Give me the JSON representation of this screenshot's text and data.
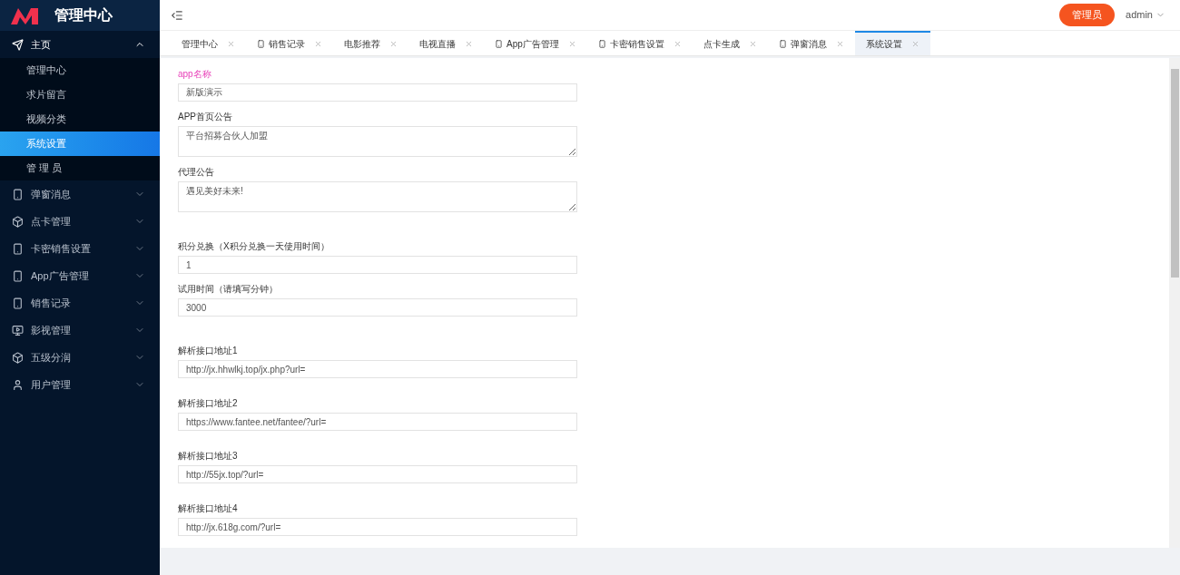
{
  "logo": {
    "title": "管理中心"
  },
  "sidebar": {
    "items": [
      {
        "label": "主页",
        "kind": "send",
        "expanded": true,
        "children": [
          {
            "label": "管理中心",
            "selected": false
          },
          {
            "label": "求片留言",
            "selected": false
          },
          {
            "label": "视频分类",
            "selected": false
          },
          {
            "label": "系统设置",
            "selected": true
          },
          {
            "label": "管 理 员",
            "selected": false
          }
        ]
      },
      {
        "label": "弹窗消息",
        "kind": "phone",
        "expanded": false
      },
      {
        "label": "点卡管理",
        "kind": "cube",
        "expanded": false
      },
      {
        "label": "卡密销售设置",
        "kind": "phone",
        "expanded": false
      },
      {
        "label": "App广告管理",
        "kind": "phone",
        "expanded": false
      },
      {
        "label": "销售记录",
        "kind": "phone",
        "expanded": false
      },
      {
        "label": "影视管理",
        "kind": "video",
        "expanded": false
      },
      {
        "label": "五级分润",
        "kind": "cube",
        "expanded": false
      },
      {
        "label": "用户管理",
        "kind": "user",
        "expanded": false
      }
    ]
  },
  "header": {
    "role_button": "管理员",
    "user": "admin"
  },
  "tabs": [
    {
      "label": "管理中心",
      "kind": "plain",
      "selected": false
    },
    {
      "label": "销售记录",
      "kind": "phone",
      "selected": false
    },
    {
      "label": "电影推荐",
      "kind": "plain",
      "selected": false
    },
    {
      "label": "电视直播",
      "kind": "plain",
      "selected": false
    },
    {
      "label": "App广告管理",
      "kind": "phone",
      "selected": false
    },
    {
      "label": "卡密销售设置",
      "kind": "phone",
      "selected": false
    },
    {
      "label": "点卡生成",
      "kind": "plain",
      "selected": false
    },
    {
      "label": "弹窗消息",
      "kind": "phone",
      "selected": false
    },
    {
      "label": "系统设置",
      "kind": "plain",
      "selected": true
    }
  ],
  "form_groups": [
    {
      "kind": "compact",
      "fields": [
        {
          "label": "app名称",
          "kind": "input",
          "highlighted": true,
          "value": "新版演示"
        },
        {
          "label": "APP首页公告",
          "kind": "textarea",
          "highlighted": false,
          "value": "平台招募合伙人加盟"
        },
        {
          "label": "代理公告",
          "kind": "textarea",
          "highlighted": false,
          "value": "遇见美好未来!"
        }
      ]
    },
    {
      "kind": "compact",
      "fields": [
        {
          "label": "积分兑换（X积分兑换一天使用时间）",
          "kind": "input",
          "highlighted": false,
          "value": "1"
        },
        {
          "label": "试用时间（请填写分钟）",
          "kind": "input",
          "highlighted": false,
          "value": "3000"
        }
      ]
    },
    {
      "kind": "spaced",
      "fields": [
        {
          "label": "解析接口地址1",
          "kind": "input",
          "highlighted": false,
          "value": "http://jx.hhwlkj.top/jx.php?url="
        },
        {
          "label": "解析接口地址2",
          "kind": "input",
          "highlighted": false,
          "value": "https://www.fantee.net/fantee/?url="
        },
        {
          "label": "解析接口地址3",
          "kind": "input",
          "highlighted": false,
          "value": "http://55jx.top/?url="
        },
        {
          "label": "解析接口地址4",
          "kind": "input",
          "highlighted": false,
          "value": "http://jx.618g.com/?url="
        }
      ]
    }
  ]
}
